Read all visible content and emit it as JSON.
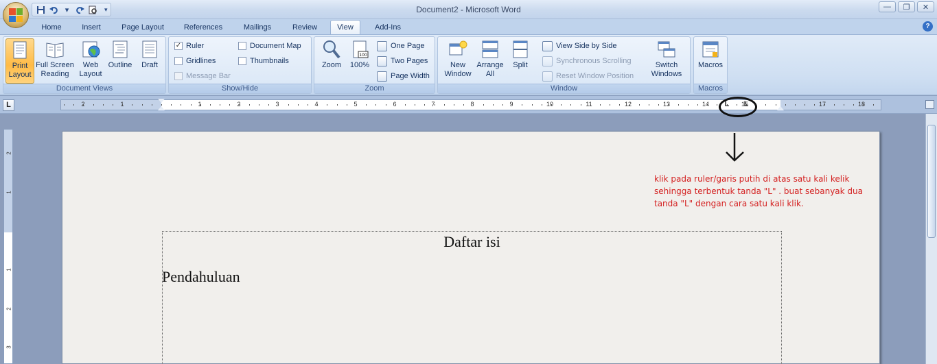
{
  "window": {
    "title": "Document2 - Microsoft Word"
  },
  "qat": {
    "items": [
      "save-icon",
      "undo-icon",
      "redo-icon",
      "print-preview-icon"
    ]
  },
  "tabs": [
    "Home",
    "Insert",
    "Page Layout",
    "References",
    "Mailings",
    "Review",
    "View",
    "Add-Ins"
  ],
  "active_tab": "View",
  "ribbon": {
    "document_views": {
      "label": "Document Views",
      "buttons": [
        {
          "line1": "Print",
          "line2": "Layout"
        },
        {
          "line1": "Full Screen",
          "line2": "Reading"
        },
        {
          "line1": "Web",
          "line2": "Layout"
        },
        {
          "line1": "Outline",
          "line2": ""
        },
        {
          "line1": "Draft",
          "line2": ""
        }
      ]
    },
    "show_hide": {
      "label": "Show/Hide",
      "ruler": "Ruler",
      "gridlines": "Gridlines",
      "message_bar": "Message Bar",
      "document_map": "Document Map",
      "thumbnails": "Thumbnails"
    },
    "zoom": {
      "label": "Zoom",
      "zoom": "Zoom",
      "hundred": "100%",
      "one_page": "One Page",
      "two_pages": "Two Pages",
      "page_width": "Page Width"
    },
    "window": {
      "label": "Window",
      "new_line1": "New",
      "new_line2": "Window",
      "arrange_line1": "Arrange",
      "arrange_line2": "All",
      "split": "Split",
      "view_side": "View Side by Side",
      "sync_scroll": "Synchronous Scrolling",
      "reset_pos": "Reset Window Position",
      "switch_line1": "Switch",
      "switch_line2": "Windows"
    },
    "macros": {
      "label": "Macros",
      "button": "Macros"
    }
  },
  "ruler": {
    "tab_selector": "L",
    "left_numbers": [
      "2",
      "1"
    ],
    "right_numbers": [
      "1",
      "2",
      "3",
      "4",
      "5",
      "6",
      "7",
      "8",
      "9",
      "10",
      "11",
      "12",
      "13",
      "14",
      "15",
      "16",
      "17",
      "18"
    ],
    "tab_stops": [
      "L",
      "L"
    ]
  },
  "vertical_ruler": {
    "numbers": [
      "2",
      "1",
      "1",
      "2",
      "3"
    ]
  },
  "document": {
    "title": "Daftar isi",
    "heading": "Pendahuluan"
  },
  "annotation": {
    "line1": "klik pada ruler/garis putih di atas satu kali kelik",
    "line2": "sehingga terbentuk tanda \"L\" . buat sebanyak dua",
    "line3": "tanda \"L\" dengan cara satu kali klik."
  },
  "colors": {
    "annotation": "#d42020",
    "ribbon": "#dfe9f5",
    "selected_button": "#ffc34f"
  }
}
